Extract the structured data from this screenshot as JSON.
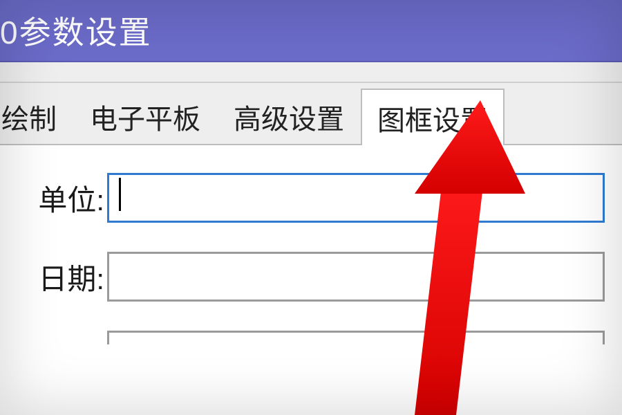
{
  "window": {
    "title_fragment": "0参数设置"
  },
  "tabs": {
    "t0": "绘制",
    "t1": "电子平板",
    "t2": "高级设置",
    "t3": "图框设置"
  },
  "form": {
    "row0_label": "单位:",
    "row0_value": "",
    "row1_label": "日期:",
    "row1_value": "",
    "row2_label": "",
    "row2_value": ""
  }
}
